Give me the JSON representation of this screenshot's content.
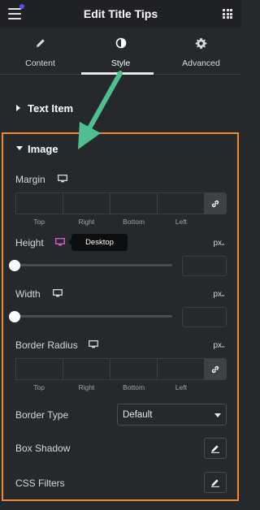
{
  "header": {
    "title": "Edit Title Tips",
    "menu_icon": "hamburger-icon",
    "apps_icon": "grid-icon"
  },
  "tabs": [
    {
      "label": "Content",
      "icon": "pencil-icon"
    },
    {
      "label": "Style",
      "icon": "half-circle-icon",
      "active": true
    },
    {
      "label": "Advanced",
      "icon": "gear-icon"
    }
  ],
  "sections": {
    "text_item": {
      "label": "Text Item",
      "expanded": false
    },
    "image": {
      "label": "Image",
      "expanded": true
    }
  },
  "margin": {
    "label": "Margin",
    "sides": [
      "Top",
      "Right",
      "Bottom",
      "Left"
    ]
  },
  "height": {
    "label": "Height",
    "unit": "px",
    "value": ""
  },
  "width": {
    "label": "Width",
    "unit": "px",
    "value": ""
  },
  "border_radius": {
    "label": "Border Radius",
    "unit": "px",
    "sides": [
      "Top",
      "Right",
      "Bottom",
      "Left"
    ]
  },
  "tooltip": {
    "text": "Desktop"
  },
  "border_type": {
    "label": "Border Type",
    "selected": "Default"
  },
  "box_shadow": {
    "label": "Box Shadow"
  },
  "css_filters": {
    "label": "CSS Filters"
  },
  "colors": {
    "accent_highlight": "#f0892e",
    "arrow": "#4fbf8f",
    "tooltip_bg": "#0c0d0e",
    "active_monitor": "#e05ad6"
  }
}
